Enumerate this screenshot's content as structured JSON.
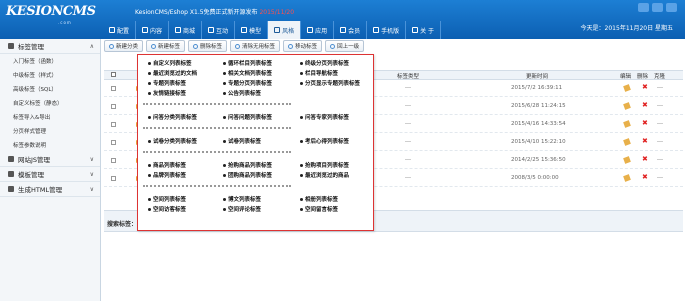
{
  "app": {
    "logo": "KESIONCMS",
    "logo_tld": ".com",
    "version_text": "KesionCMS/Eshop X1.5免费正式新开源发布",
    "version_highlight": "2015/11/20",
    "date_text": "今天是：2015年11月20日 星期五"
  },
  "nav": [
    {
      "label": "配置",
      "icon": "gear-icon"
    },
    {
      "label": "内容",
      "icon": "document-icon"
    },
    {
      "label": "商城",
      "icon": "shop-icon"
    },
    {
      "label": "互动",
      "icon": "chat-icon"
    },
    {
      "label": "模型",
      "icon": "model-icon"
    },
    {
      "label": "风格",
      "icon": "brush-icon",
      "active": true
    },
    {
      "label": "应用",
      "icon": "apps-icon"
    },
    {
      "label": "会员",
      "icon": "user-icon"
    },
    {
      "label": "手机版",
      "icon": "mobile-icon"
    },
    {
      "label": "关 于",
      "icon": "info-icon"
    }
  ],
  "sidebar": {
    "group1": "标签管理",
    "items": [
      "入门标签（函数）",
      "中级标签（样式）",
      "高级标签（SQL）",
      "自定义标签（静态）",
      "标签导入&导出",
      "分页样式管理",
      "标签参数说明"
    ],
    "groups": [
      "网站JS管理",
      "模板管理",
      "生成HTML管理"
    ]
  },
  "toolbar": [
    "新建分类",
    "新建标签",
    "删除标签",
    "清除无用标签",
    "移动标签",
    "回上一级"
  ],
  "grid": {
    "headers": [
      "标签类型",
      "更新时间",
      "编辑",
      "删除",
      "克隆"
    ],
    "rows": [
      {
        "type": "---",
        "time": "2015/7/2 16:39:11",
        "clone": "---"
      },
      {
        "type": "---",
        "time": "2015/6/28 11:24:15",
        "clone": "---"
      },
      {
        "type": "---",
        "time": "2015/4/16 14:33:54",
        "clone": "---"
      },
      {
        "type": "---",
        "time": "2015/4/10 15:22:10",
        "clone": "---"
      },
      {
        "type": "---",
        "time": "2014/2/25 15:36:50",
        "clone": "---"
      },
      {
        "type": "---",
        "time": "2008/3/5 0:00:00",
        "clone": "---"
      }
    ],
    "search_label": "搜索标签："
  },
  "popup": {
    "section1": [
      [
        "自定义列表标签",
        "循环栏目列表标签",
        "终级分页列表标签"
      ],
      [
        "最近浏览过的文档",
        "相关文档列表标签",
        "栏目导航标签"
      ],
      [
        "专题列表标签",
        "专题分页列表标签",
        "分页显示专题列表标签"
      ],
      [
        "友情链接标签",
        "公告列表标签",
        ""
      ]
    ],
    "section2": [
      [
        "问答分类列表标签",
        "问答问题列表标签",
        "问答专家列表标签"
      ]
    ],
    "section3": [
      [
        "试卷分类列表标签",
        "试卷列表标签",
        "考后心得列表标签"
      ]
    ],
    "section4": [
      [
        "商品列表标签",
        "抢购商品列表标签",
        "抢购项目列表标签"
      ],
      [
        "品牌列表标签",
        "团购商品列表标签",
        "最近浏览过的商品"
      ]
    ],
    "section5": [
      [
        "空间列表标签",
        "博文列表标签",
        "相册列表标签"
      ],
      [
        "空间访客标签",
        "空间评论标签",
        "空间留言标签"
      ]
    ]
  },
  "colors": {
    "topbar": "#0c5fb2",
    "popup_border": "#dd3333",
    "delete_red": "#e02020"
  }
}
